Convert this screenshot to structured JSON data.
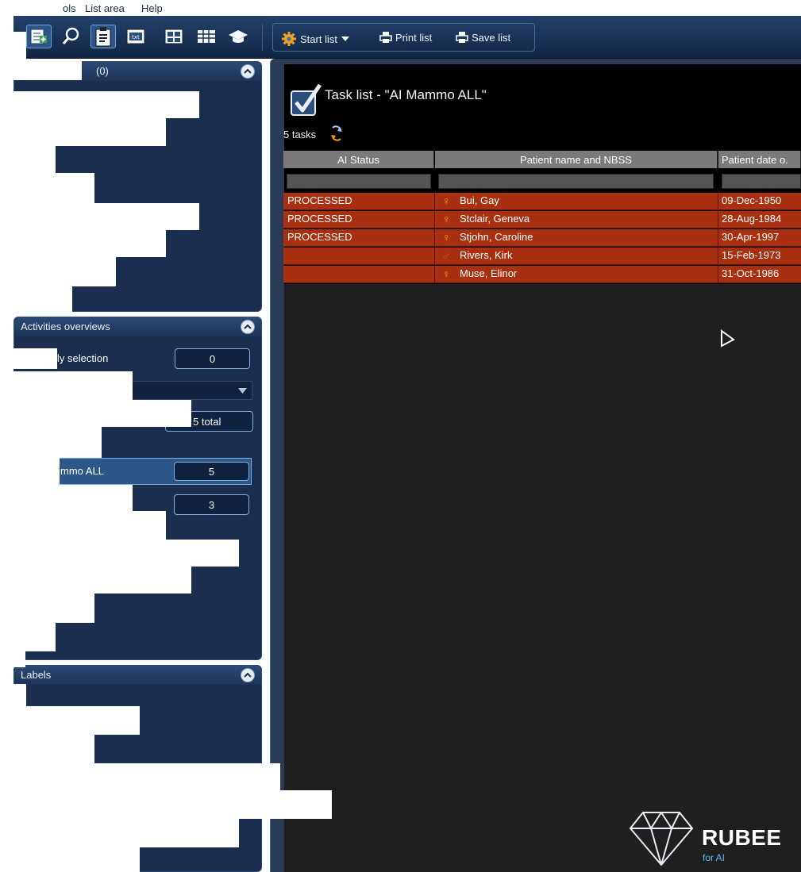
{
  "menubar": {
    "items": [
      "ols",
      "List area",
      "Help"
    ]
  },
  "toolbar": {
    "start_list_label": "Start list",
    "print_list_label": "Print list",
    "save_list_label": "Save list",
    "txt_icon_label": "txt"
  },
  "panels": {
    "top": {
      "title": "(0)"
    },
    "activities": {
      "title": "Activities overviews",
      "selection_label": "ly selection",
      "selection_count": "0",
      "total_label": "5 total",
      "mammo_label": "mmo ALL",
      "mammo_count": "5",
      "third_count": "3"
    },
    "labels": {
      "title": "Labels"
    }
  },
  "tasklist": {
    "title": "Task list - \"AI Mammo ALL\"",
    "count_label": "5 tasks",
    "columns": [
      "AI Status",
      "Patient name and NBSS",
      "Patient date o."
    ],
    "rows": [
      {
        "status": "PROCESSED",
        "sex": "♀",
        "name": "Bui, Gay",
        "dob": "09-Dec-1950"
      },
      {
        "status": "PROCESSED",
        "sex": "♀",
        "name": "Stclair, Geneva",
        "dob": "28-Aug-1984"
      },
      {
        "status": "PROCESSED",
        "sex": "♀",
        "name": "Stjohn, Caroline",
        "dob": "30-Apr-1997"
      },
      {
        "status": "",
        "sex": "♂",
        "name": "Rivers, Kirk",
        "dob": "15-Feb-1973"
      },
      {
        "status": "",
        "sex": "♀",
        "name": "Muse, Elinor",
        "dob": "31-Oct-1986"
      }
    ]
  },
  "logo": {
    "name": "RUBEE",
    "sub": "for AI"
  },
  "colors": {
    "toolbar_bg": "#1a3458",
    "panel_bg": "#1a2e4f",
    "row_highlight": "#a83010",
    "female_icon": "#f0a020",
    "logo_accent": "#5ab8ee"
  }
}
